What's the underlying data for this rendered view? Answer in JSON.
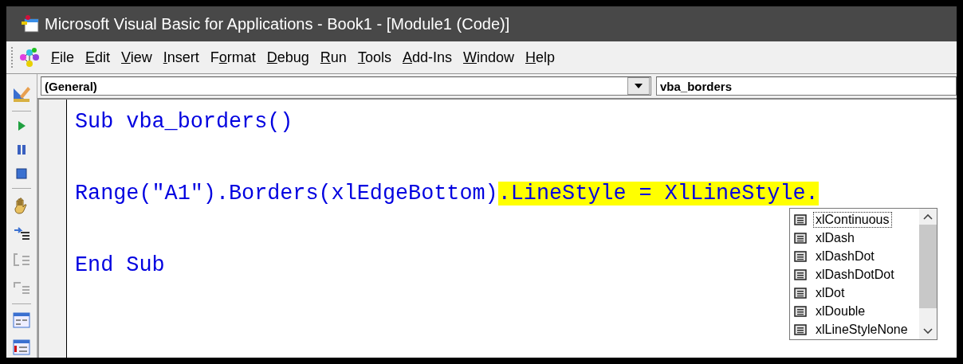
{
  "window": {
    "title": "Microsoft Visual Basic for Applications - Book1 - [Module1 (Code)]"
  },
  "menu": [
    {
      "segments": [
        {
          "text": "F",
          "underlined": true
        },
        {
          "text": "ile",
          "underlined": false
        }
      ]
    },
    {
      "segments": [
        {
          "text": "E",
          "underlined": true
        },
        {
          "text": "dit",
          "underlined": false
        }
      ]
    },
    {
      "segments": [
        {
          "text": "V",
          "underlined": true
        },
        {
          "text": "iew",
          "underlined": false
        }
      ]
    },
    {
      "segments": [
        {
          "text": "I",
          "underlined": true
        },
        {
          "text": "nsert",
          "underlined": false
        }
      ]
    },
    {
      "segments": [
        {
          "text": "F",
          "underlined": false
        },
        {
          "text": "o",
          "underlined": true
        },
        {
          "text": "rmat",
          "underlined": false
        }
      ]
    },
    {
      "segments": [
        {
          "text": "D",
          "underlined": true
        },
        {
          "text": "ebug",
          "underlined": false
        }
      ]
    },
    {
      "segments": [
        {
          "text": "R",
          "underlined": true
        },
        {
          "text": "un",
          "underlined": false
        }
      ]
    },
    {
      "segments": [
        {
          "text": "T",
          "underlined": true
        },
        {
          "text": "ools",
          "underlined": false
        }
      ]
    },
    {
      "segments": [
        {
          "text": "A",
          "underlined": true
        },
        {
          "text": "dd-Ins",
          "underlined": false
        }
      ]
    },
    {
      "segments": [
        {
          "text": "W",
          "underlined": true
        },
        {
          "text": "indow",
          "underlined": false
        }
      ]
    },
    {
      "segments": [
        {
          "text": "H",
          "underlined": true
        },
        {
          "text": "elp",
          "underlined": false
        }
      ]
    }
  ],
  "object_combo": {
    "value": "(General)"
  },
  "procedure_combo": {
    "value": "vba_borders"
  },
  "code_lines": [
    {
      "segments": [
        {
          "text": "Sub vba_borders()",
          "highlighted": false
        }
      ]
    },
    {
      "segments": [
        {
          "text": "Range(\"A1\").Borders(xlEdgeBottom)",
          "highlighted": false
        },
        {
          "text": ".LineStyle = XlLineStyle.",
          "highlighted": true
        }
      ]
    },
    {
      "segments": [
        {
          "text": "End Sub",
          "highlighted": false
        }
      ]
    }
  ],
  "autocomplete": {
    "items": [
      {
        "label": "xlContinuous",
        "selected": true
      },
      {
        "label": "xlDash",
        "selected": false
      },
      {
        "label": "xlDashDot",
        "selected": false
      },
      {
        "label": "xlDashDotDot",
        "selected": false
      },
      {
        "label": "xlDot",
        "selected": false
      },
      {
        "label": "xlDouble",
        "selected": false
      },
      {
        "label": "xlLineStyleNone",
        "selected": false
      }
    ]
  }
}
